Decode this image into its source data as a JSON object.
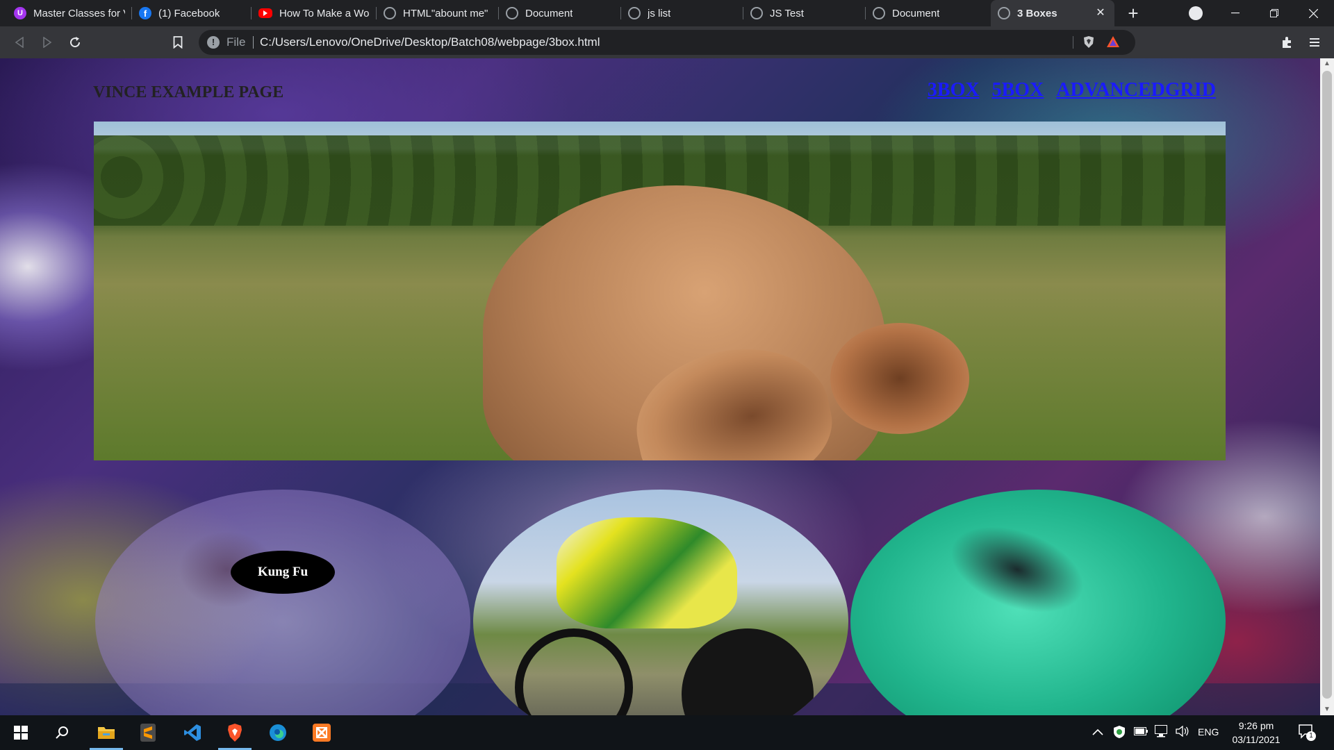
{
  "browser": {
    "tabs": [
      {
        "title": "Master Classes for V",
        "icon": "udemy-icon",
        "color": "#a435f0"
      },
      {
        "title": "(1) Facebook",
        "icon": "facebook-icon",
        "color": "#1877f2"
      },
      {
        "title": "How To Make a Wo",
        "icon": "youtube-icon",
        "color": "#ff0000"
      },
      {
        "title": "HTML\"abount me\"",
        "icon": "globe-icon",
        "color": "#9aa0a6"
      },
      {
        "title": "Document",
        "icon": "globe-icon",
        "color": "#9aa0a6"
      },
      {
        "title": "js list",
        "icon": "globe-icon",
        "color": "#9aa0a6"
      },
      {
        "title": "JS Test",
        "icon": "globe-icon",
        "color": "#9aa0a6"
      },
      {
        "title": "Document",
        "icon": "globe-icon",
        "color": "#9aa0a6"
      },
      {
        "title": "3 Boxes",
        "icon": "globe-icon",
        "color": "#9aa0a6",
        "active": true
      }
    ],
    "omnibox": {
      "scheme_label": "File",
      "url": "C:/Users/Lenovo/OneDrive/Desktop/Batch08/webpage/3box.html"
    }
  },
  "page": {
    "site_title": "VINCE EXAMPLE PAGE",
    "nav": [
      "3BOX",
      "5BOX",
      "ADVANCEDGRID"
    ],
    "kungfu_label": "Kung Fu"
  },
  "taskbar": {
    "apps": [
      "start-icon",
      "search-icon",
      "file-explorer-icon",
      "sublime-text-icon",
      "vscode-icon",
      "brave-icon",
      "edge-icon",
      "xampp-icon"
    ],
    "language": "ENG",
    "time": "9:26 pm",
    "date": "03/11/2021",
    "notification_count": "1"
  },
  "colors": {
    "brave_orange": "#fb542b",
    "link_blue": "#1a1aff"
  }
}
